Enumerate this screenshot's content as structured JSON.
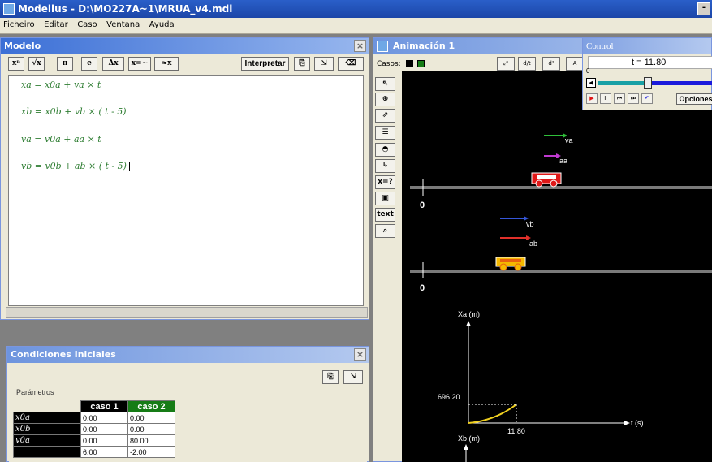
{
  "window": {
    "title": "Modellus - D:\\MO227A~1\\MRUA_v4.mdl",
    "minimize_glyph": "-"
  },
  "menu": [
    "Ficheiro",
    "Editar",
    "Caso",
    "Ventana",
    "Ayuda"
  ],
  "modelo": {
    "title": "Modelo",
    "close_glyph": "×",
    "toolbar": [
      "xⁿ",
      "√x",
      "π",
      "e",
      "Δx",
      "x=~",
      "≈x"
    ],
    "interpret_label": "Interpretar",
    "equations": [
      "xa = x0a + va × t",
      "xb = x0b + vb × ( t - 5)",
      "va = v0a + aa × t",
      "vb = v0b + ab × ( t - 5)"
    ]
  },
  "condiciones": {
    "title": "Condiciones Iniciales",
    "close_glyph": "×",
    "params_label": "Parámetros",
    "headers": [
      "caso 1",
      "caso 2"
    ],
    "rows": [
      {
        "name": "x0a",
        "c1": "0.00",
        "c2": "0.00"
      },
      {
        "name": "x0b",
        "c1": "0.00",
        "c2": "0.00"
      },
      {
        "name": "v0a",
        "c1": "0.00",
        "c2": "80.00"
      },
      {
        "name": "",
        "c1": "6.00",
        "c2": "-2.00"
      }
    ]
  },
  "animacion": {
    "title": "Animación 1",
    "casos_label": "Casos:",
    "left_tools": [
      "⇖",
      "⊕",
      "⇗",
      "☰",
      "◓",
      "↳",
      "x=?",
      "▣",
      "text",
      "⌕"
    ],
    "text_tool_label": "text",
    "labels": {
      "va": "va",
      "aa": "aa",
      "vb": "vb",
      "ab": "ab",
      "zero1": "0",
      "zero2": "0"
    },
    "graph1": {
      "ylabel": "Xa (m)",
      "xlabel": "t (s)",
      "yvalue": "696.20",
      "xvalue": "11.80"
    },
    "graph2": {
      "ylabel": "Xb (m)"
    }
  },
  "control": {
    "title": "Control",
    "t_display": "t =  11.80",
    "t_min": "0",
    "opciones_label": "Opciones",
    "slider_fraction": 0.44
  },
  "colors": {
    "va_arrow": "#2fbf3a",
    "aa_arrow": "#c03ad0",
    "vb_arrow": "#3556d8",
    "ab_arrow": "#e0302a",
    "cart_a": "#e01818",
    "cart_b": "#f5b800",
    "trajectory": "#f0d020"
  }
}
